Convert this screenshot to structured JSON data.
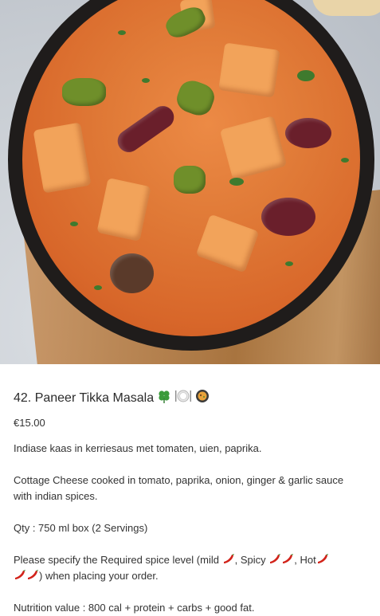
{
  "product": {
    "image_alt": "Paneer Tikka Masala",
    "name": "42. Paneer Tikka Masala",
    "badges": [
      "clover-icon",
      "plate-icon",
      "curry-bowl-icon"
    ],
    "price": "€15.00",
    "description_nl": "Indiase kaas in kerriesaus met tomaten, uien, paprika.",
    "description_en": "Cottage Cheese cooked in tomato, paprika, onion, ginger & garlic sauce with indian spices.",
    "quantity": "Qty : 750 ml box (2 Servings)",
    "spice_note": {
      "prefix": "Please specify the Required spice level (mild",
      "spicy": ", Spicy",
      "hot": ", Hot",
      "suffix": ") when placing your order."
    },
    "nutrition": "Nutrition value : 800 cal + protein + carbs + good fat."
  },
  "colors": {
    "text": "#2b2b2b",
    "clover": "#3a9b3a",
    "chili": "#d2231a"
  }
}
